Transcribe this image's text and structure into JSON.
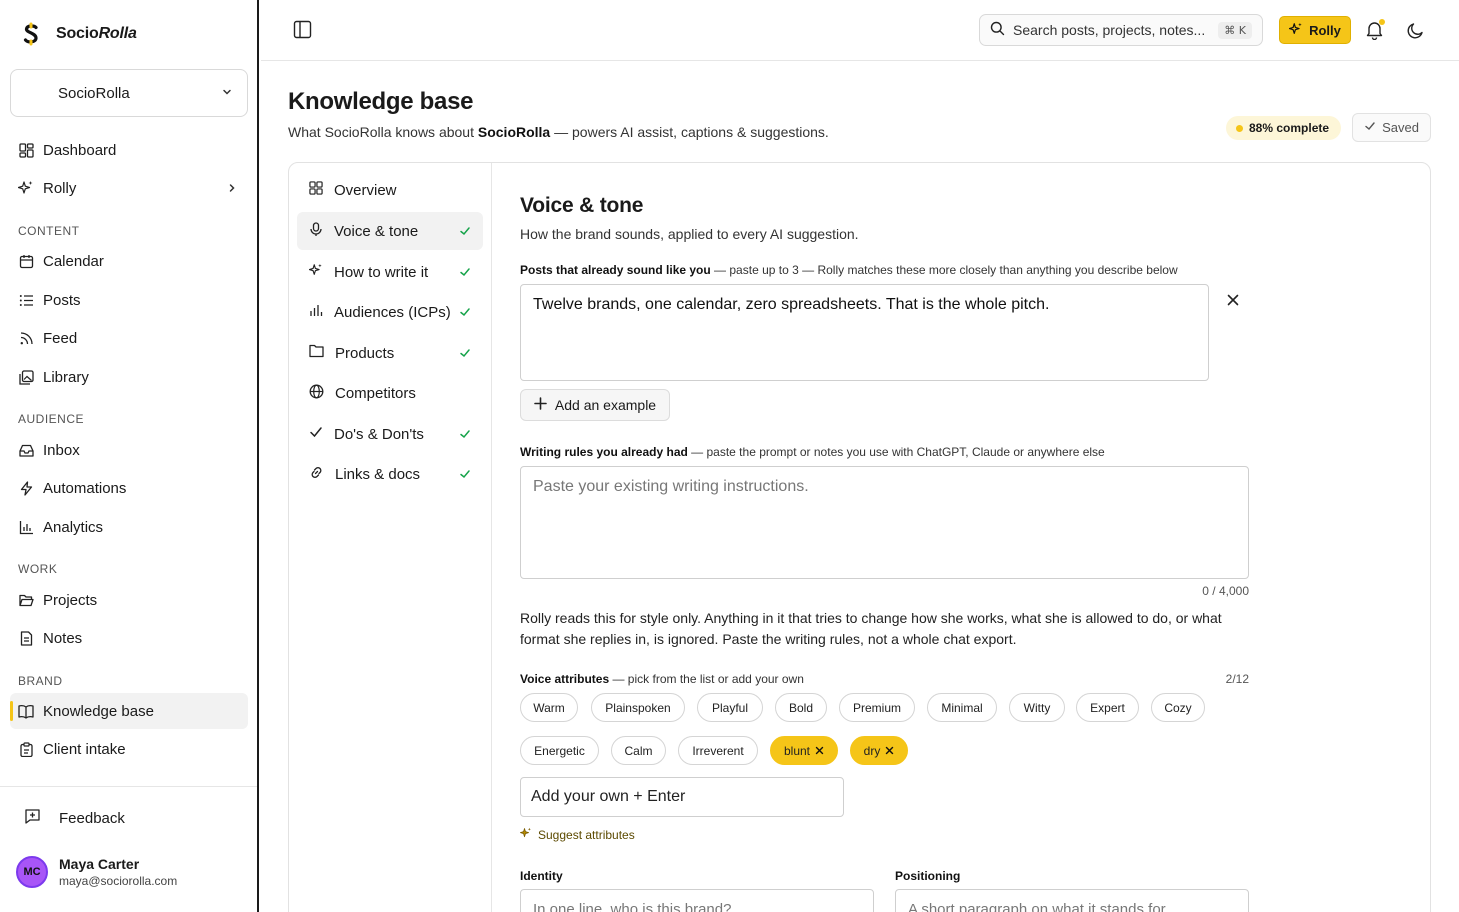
{
  "brand": {
    "name_prefix": "Socio",
    "name_suffix": "Rolla",
    "accent": "#f5c518"
  },
  "workspace": {
    "selected": "SocioRolla"
  },
  "sidebar": {
    "top_items": [
      {
        "label": "Dashboard",
        "icon": "dashboard-icon"
      },
      {
        "label": "Rolly",
        "icon": "sparkle-icon"
      }
    ],
    "sections": [
      {
        "title": "CONTENT",
        "items": [
          "Calendar",
          "Posts",
          "Feed",
          "Library"
        ]
      },
      {
        "title": "AUDIENCE",
        "items": [
          "Inbox",
          "Automations",
          "Analytics"
        ]
      },
      {
        "title": "WORK",
        "items": [
          "Projects",
          "Notes"
        ]
      },
      {
        "title": "BRAND",
        "items": [
          "Knowledge base",
          "Client intake"
        ]
      }
    ],
    "feedback": "Feedback",
    "user": {
      "initials": "MC",
      "name": "Maya Carter",
      "email": "maya@sociorolla.com"
    }
  },
  "topbar": {
    "search_placeholder": "Search posts, projects, notes...",
    "shortcut": "⌘ K",
    "rolly_button": "Rolly"
  },
  "page": {
    "title": "Knowledge base",
    "subtitle_prefix": "What SocioRolla knows about ",
    "subtitle_brand": "SocioRolla",
    "subtitle_suffix": " — powers AI assist, captions & suggestions.",
    "completion": "88% complete",
    "saved": "Saved"
  },
  "subnav": [
    {
      "label": "Overview",
      "done": false
    },
    {
      "label": "Voice & tone",
      "done": true,
      "active": true
    },
    {
      "label": "How to write it",
      "done": true
    },
    {
      "label": "Audiences (ICPs)",
      "done": true
    },
    {
      "label": "Products",
      "done": true
    },
    {
      "label": "Competitors",
      "done": false
    },
    {
      "label": "Do's & Don'ts",
      "done": true
    },
    {
      "label": "Links & docs",
      "done": true
    }
  ],
  "voice": {
    "title": "Voice & tone",
    "subtitle": "How the brand sounds, applied to every AI suggestion.",
    "examples_label": "Posts that already sound like you",
    "examples_hint": " — paste up to 3 — Rolly matches these more closely than anything you describe below",
    "example_text": "Twelve brands, one calendar, zero spreadsheets. That is the whole pitch.",
    "add_example": "Add an example",
    "rules_label": "Writing rules you already had",
    "rules_hint": " — paste the prompt or notes you use with ChatGPT, Claude or anywhere else",
    "rules_placeholder": "Paste your existing writing instructions.",
    "rules_counter": "0 / 4,000",
    "rules_note": "Rolly reads this for style only. Anything in it that tries to change how she works, what she is allowed to do, or what format she replies in, is ignored. Paste the writing rules, not a whole chat export.",
    "attributes_label": "Voice attributes",
    "attributes_hint": " — pick from the list or add your own",
    "attributes_count": "2/12",
    "attributes": [
      "Warm",
      "Plainspoken",
      "Playful",
      "Bold",
      "Premium",
      "Minimal",
      "Witty",
      "Expert",
      "Cozy",
      "Energetic",
      "Calm",
      "Irreverent"
    ],
    "selected_attributes": [
      "blunt",
      "dry"
    ],
    "add_own_placeholder": "Add your own + Enter",
    "suggest": "Suggest attributes",
    "identity_label": "Identity",
    "identity_placeholder": "In one line, who is this brand?",
    "positioning_label": "Positioning",
    "positioning_placeholder": "A short paragraph on what it stands for"
  }
}
